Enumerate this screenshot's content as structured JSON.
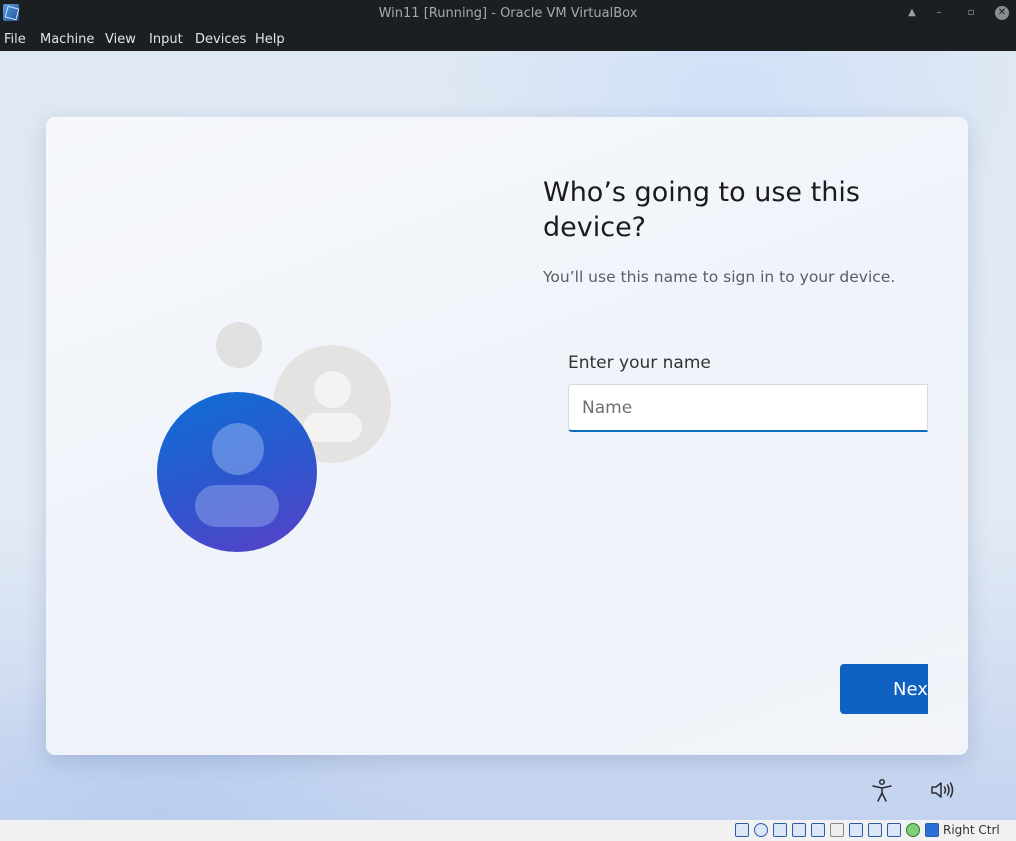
{
  "window": {
    "title": "Win11 [Running] - Oracle VM VirtualBox"
  },
  "menubar": {
    "items": [
      "File",
      "Machine",
      "View",
      "Input",
      "Devices",
      "Help"
    ]
  },
  "setup": {
    "heading": "Who’s going to use this device?",
    "subtitle": "You’ll use this name to sign in to your device.",
    "field_label": "Enter your name",
    "name_value": "",
    "name_placeholder": "Name",
    "next_label": "Next",
    "accent_color": "#0f62c2"
  },
  "tray": {
    "accessibility_icon": "accessibility-icon",
    "volume_icon": "volume-icon"
  },
  "statusbar": {
    "host_key": "Right Ctrl"
  }
}
